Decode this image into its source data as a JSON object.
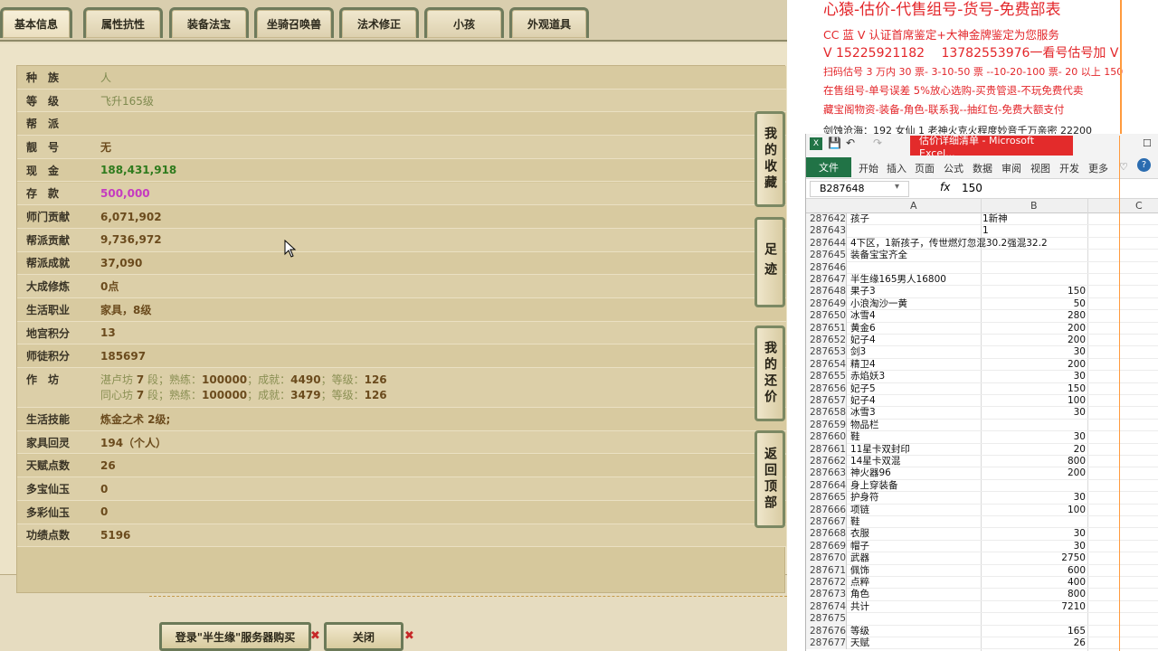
{
  "tabs": [
    "基本信息",
    "属性抗性",
    "装备法宝",
    "坐骑召唤兽",
    "法术修正",
    "小孩",
    "外观道具"
  ],
  "active_tab": "基本信息",
  "rows": [
    {
      "label": "种　族",
      "value": "人",
      "style": "light"
    },
    {
      "label": "等　级",
      "value": "飞升165级",
      "style": "light"
    },
    {
      "label": "帮　派",
      "value": "",
      "style": "light"
    },
    {
      "label": "靓　号",
      "value": "无",
      "style": "normal"
    },
    {
      "label": "现　金",
      "value": "188,431,918",
      "style": "green"
    },
    {
      "label": "存　款",
      "value": "500,000",
      "style": "pink"
    },
    {
      "label": "师门贡献",
      "value": "6,071,902",
      "style": "normal"
    },
    {
      "label": "帮派贡献",
      "value": "9,736,972",
      "style": "normal"
    },
    {
      "label": "帮派成就",
      "value": "37,090",
      "style": "normal"
    },
    {
      "label": "大成修炼",
      "value": "0点",
      "style": "normal"
    },
    {
      "label": "生活职业",
      "value": "家具，8级",
      "style": "normal"
    },
    {
      "label": "地宫积分",
      "value": "13",
      "style": "normal"
    },
    {
      "label": "师徒积分",
      "value": "185697",
      "style": "normal"
    }
  ],
  "workshop": {
    "label": "作　坊",
    "lines": [
      {
        "name": "湛卢坊",
        "level": "7",
        "proficiency": "100000",
        "achievement": "4490",
        "grade": "126"
      },
      {
        "name": "同心坊",
        "level": "7",
        "proficiency": "100000",
        "achievement": "3479",
        "grade": "126"
      }
    ],
    "segment_word": "段；熟练：",
    "achieve_word": "；成就：",
    "grade_word": "；等级："
  },
  "rows2": [
    {
      "label": "生活技能",
      "value": "炼金之术 2级;"
    },
    {
      "label": "家具回灵",
      "value": "194（个人）"
    },
    {
      "label": "天赋点数",
      "value": "26"
    },
    {
      "label": "多宝仙玉",
      "value": "0"
    },
    {
      "label": "多彩仙玉",
      "value": "0"
    },
    {
      "label": "功绩点数",
      "value": "5196"
    }
  ],
  "side_buttons": [
    "我的收藏",
    "足迹",
    "我的还价",
    "返回顶部"
  ],
  "bottom_buttons": {
    "buy": "登录\"半生缘\"服务器购买",
    "close": "关闭"
  },
  "promo": {
    "line0": "心猿-估价-代售组号-货号-免费部表",
    "line1": "CC 蓝 V 认证首席鉴定+大神金牌鉴定为您服务",
    "line2": "V 15225921182　 13782553976一看号估号加 V",
    "line3": "扫码估号 3 万内 30 票- 3-10-50 票 --10-20-100 票- 20 以上 150",
    "line4": "在售组号-单号误差 5%放心选购-买贵管退-不玩免费代卖",
    "line5": "藏宝阁物资-装备-角色-联系我--抽红包-免费大额支付",
    "line6": "剑蚀沧海：192 女仙 1 老神火克火程度妙音千万亲密 22200"
  },
  "excel": {
    "title": "估价详细清单 - Microsoft Excel...",
    "file_tab": "文件",
    "ribbon": [
      "开始",
      "插入",
      "页面",
      "公式",
      "数据",
      "审阅",
      "视图",
      "开发",
      "更多"
    ],
    "name_box": "B287648",
    "formula_value": "150",
    "columns": [
      "A",
      "B",
      "C"
    ],
    "rows": [
      {
        "n": "287642",
        "a": "孩子",
        "b": "1新神",
        "bl": true
      },
      {
        "n": "287643",
        "a": "",
        "b": "1",
        "bl": true
      },
      {
        "n": "287644",
        "a": "4下区，1新孩子，传世燃灯忽混30.2强混32.2",
        "b": ""
      },
      {
        "n": "287645",
        "a": "装备宝宝齐全",
        "b": ""
      },
      {
        "n": "287646",
        "a": "",
        "b": ""
      },
      {
        "n": "287647",
        "a": "半生缘165男人16800",
        "b": ""
      },
      {
        "n": "287648",
        "a": "果子3",
        "b": "150"
      },
      {
        "n": "287649",
        "a": "小浪淘沙一黄",
        "b": "50"
      },
      {
        "n": "287650",
        "a": "冰雪4",
        "b": "280"
      },
      {
        "n": "287651",
        "a": "黄金6",
        "b": "200"
      },
      {
        "n": "287652",
        "a": "妃子4",
        "b": "200"
      },
      {
        "n": "287653",
        "a": "剑3",
        "b": "30"
      },
      {
        "n": "287654",
        "a": "精卫4",
        "b": "200"
      },
      {
        "n": "287655",
        "a": "赤焰妖3",
        "b": "30"
      },
      {
        "n": "287656",
        "a": "妃子5",
        "b": "150"
      },
      {
        "n": "287657",
        "a": "妃子4",
        "b": "100"
      },
      {
        "n": "287658",
        "a": "冰雪3",
        "b": "30"
      },
      {
        "n": "287659",
        "a": "物品栏",
        "b": ""
      },
      {
        "n": "287660",
        "a": "鞋",
        "b": "30"
      },
      {
        "n": "287661",
        "a": "11星卡双封印",
        "b": "20"
      },
      {
        "n": "287662",
        "a": "14星卡双混",
        "b": "800"
      },
      {
        "n": "287663",
        "a": "神火器96",
        "b": "200"
      },
      {
        "n": "287664",
        "a": "身上穿装备",
        "b": ""
      },
      {
        "n": "287665",
        "a": "护身符",
        "b": "30"
      },
      {
        "n": "287666",
        "a": "项链",
        "b": "100"
      },
      {
        "n": "287667",
        "a": "鞋",
        "b": ""
      },
      {
        "n": "287668",
        "a": "衣服",
        "b": "30"
      },
      {
        "n": "287669",
        "a": "帽子",
        "b": "30"
      },
      {
        "n": "287670",
        "a": "武器",
        "b": "2750"
      },
      {
        "n": "287671",
        "a": "佩饰",
        "b": "600"
      },
      {
        "n": "287672",
        "a": "点粹",
        "b": "400"
      },
      {
        "n": "287673",
        "a": "角色",
        "b": "800"
      },
      {
        "n": "287674",
        "a": "共计",
        "b": "7210"
      },
      {
        "n": "287675",
        "a": "",
        "b": ""
      },
      {
        "n": "287676",
        "a": "等级",
        "b": "165"
      },
      {
        "n": "287677",
        "a": "天赋",
        "b": "26"
      }
    ]
  },
  "colors": {
    "cash": "#2f7b1d",
    "deposit": "#c53bc0",
    "promo_red": "#e3262a",
    "excel_green": "#217346"
  }
}
